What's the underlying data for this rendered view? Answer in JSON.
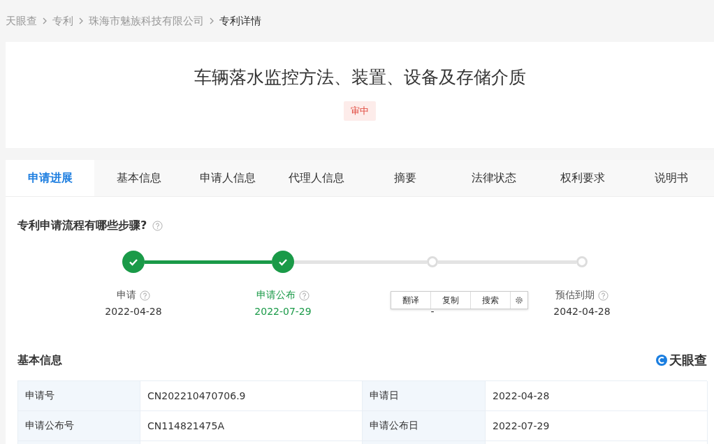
{
  "breadcrumb": [
    {
      "label": "天眼查",
      "current": false
    },
    {
      "label": "专利",
      "current": false
    },
    {
      "label": "珠海市魅族科技有限公司",
      "current": false
    },
    {
      "label": "专利详情",
      "current": true
    }
  ],
  "title": "车辆落水监控方法、装置、设备及存储介质",
  "status_tag": "审中",
  "tabs": [
    {
      "label": "申请进展",
      "selected": true
    },
    {
      "label": "基本信息",
      "selected": false
    },
    {
      "label": "申请人信息",
      "selected": false
    },
    {
      "label": "代理人信息",
      "selected": false
    },
    {
      "label": "摘要",
      "selected": false
    },
    {
      "label": "法律状态",
      "selected": false
    },
    {
      "label": "权利要求",
      "selected": false
    },
    {
      "label": "说明书",
      "selected": false
    }
  ],
  "progress": {
    "heading": "专利申请流程有哪些步骤?",
    "steps": [
      {
        "label": "申请",
        "date": "2022-04-28",
        "done": true,
        "highlighted": false
      },
      {
        "label": "申请公布",
        "date": "2022-07-29",
        "done": true,
        "highlighted": true
      },
      {
        "date": "-",
        "done": false,
        "highlighted": false
      },
      {
        "label": "预估到期",
        "date": "2042-04-28",
        "done": false,
        "highlighted": false
      }
    ],
    "popup": {
      "buttons": [
        "翻译",
        "复制",
        "搜索"
      ]
    }
  },
  "basic_info": {
    "heading": "基本信息",
    "logo": "天眼查",
    "rows": [
      {
        "cells": [
          "申请号",
          "CN202210470706.9",
          "申请日",
          "2022-04-28"
        ]
      },
      {
        "cells": [
          "申请公布号",
          "CN114821475A",
          "申请公布日",
          "2022-07-29"
        ]
      },
      {
        "cells": []
      }
    ]
  }
}
